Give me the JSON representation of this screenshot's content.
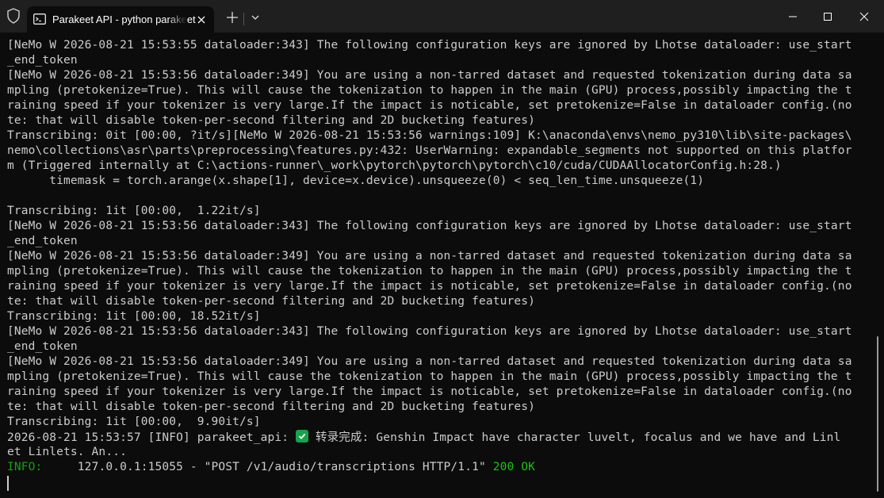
{
  "titlebar": {
    "tab_title": "Parakeet API - python  parakeet"
  },
  "icons": {
    "shield": "shield-icon",
    "terminal": "terminal-icon",
    "close_tab": "close-icon",
    "new_tab": "plus-icon",
    "dropdown": "chevron-down-icon",
    "minimize": "minimize-icon",
    "maximize": "maximize-icon",
    "close_window": "close-icon"
  },
  "colors": {
    "background": "#0c0c0c",
    "text": "#cccccc",
    "info": "#13a10e",
    "ok": "#16c60c"
  },
  "terminal": {
    "lines": [
      "[NeMo W 2026-08-21 15:53:55 dataloader:343] The following configuration keys are ignored by Lhotse dataloader: use_start",
      "_end_token",
      "[NeMo W 2026-08-21 15:53:56 dataloader:349] You are using a non-tarred dataset and requested tokenization during data sa",
      "mpling (pretokenize=True). This will cause the tokenization to happen in the main (GPU) process,possibly impacting the t",
      "raining speed if your tokenizer is very large.If the impact is noticable, set pretokenize=False in dataloader config.(no",
      "te: that will disable token-per-second filtering and 2D bucketing features)",
      "Transcribing: 0it [00:00, ?it/s][NeMo W 2026-08-21 15:53:56 warnings:109] K:\\anaconda\\envs\\nemo_py310\\lib\\site-packages\\",
      "nemo\\collections\\asr\\parts\\preprocessing\\features.py:432: UserWarning: expandable_segments not supported on this platfor",
      "m (Triggered internally at C:\\actions-runner\\_work\\pytorch\\pytorch\\pytorch\\c10/cuda/CUDAAllocatorConfig.h:28.)",
      "      timemask = torch.arange(x.shape[1], device=x.device).unsqueeze(0) < seq_len_time.unsqueeze(1)",
      "",
      "Transcribing: 1it [00:00,  1.22it/s]",
      "[NeMo W 2026-08-21 15:53:56 dataloader:343] The following configuration keys are ignored by Lhotse dataloader: use_start",
      "_end_token",
      "[NeMo W 2026-08-21 15:53:56 dataloader:349] You are using a non-tarred dataset and requested tokenization during data sa",
      "mpling (pretokenize=True). This will cause the tokenization to happen in the main (GPU) process,possibly impacting the t",
      "raining speed if your tokenizer is very large.If the impact is noticable, set pretokenize=False in dataloader config.(no",
      "te: that will disable token-per-second filtering and 2D bucketing features)",
      "Transcribing: 1it [00:00, 18.52it/s]",
      "[NeMo W 2026-08-21 15:53:56 dataloader:343] The following configuration keys are ignored by Lhotse dataloader: use_start",
      "_end_token",
      "[NeMo W 2026-08-21 15:53:56 dataloader:349] You are using a non-tarred dataset and requested tokenization during data sa",
      "mpling (pretokenize=True). This will cause the tokenization to happen in the main (GPU) process,possibly impacting the t",
      "raining speed if your tokenizer is very large.If the impact is noticable, set pretokenize=False in dataloader config.(no",
      "te: that will disable token-per-second filtering and 2D bucketing features)",
      "Transcribing: 1it [00:00,  9.90it/s]"
    ],
    "result_prefix": "2026-08-21 15:53:57 [INFO] parakeet_api: ",
    "result_icon": "check-mark-icon",
    "result_text": " 转录完成: Genshin Impact have character luvelt, focalus and we have and Linl",
    "result_cont": "et Linlets. An...",
    "access_level": "INFO:",
    "access_message": "     127.0.0.1:15055 - \"POST /v1/audio/transcriptions HTTP/1.1\" ",
    "access_status": "200 OK"
  }
}
